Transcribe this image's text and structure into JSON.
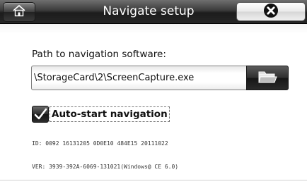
{
  "titlebar": {
    "title": "Navigate setup",
    "home_icon": "home-icon",
    "close_icon": "close-x-icon"
  },
  "path": {
    "label": "Path to navigation software:",
    "value": "\\StorageCard\\2\\ScreenCapture.exe",
    "browse_icon": "folder-icon"
  },
  "autostart": {
    "label": "Auto-start navigation",
    "checked": true
  },
  "info": {
    "id_line": "ID: 0092 16131205 0D0E10 484E15 20111022",
    "ver_line": "VER: 3939-392A-6069-131021(Windows@ CE 6.0)"
  }
}
